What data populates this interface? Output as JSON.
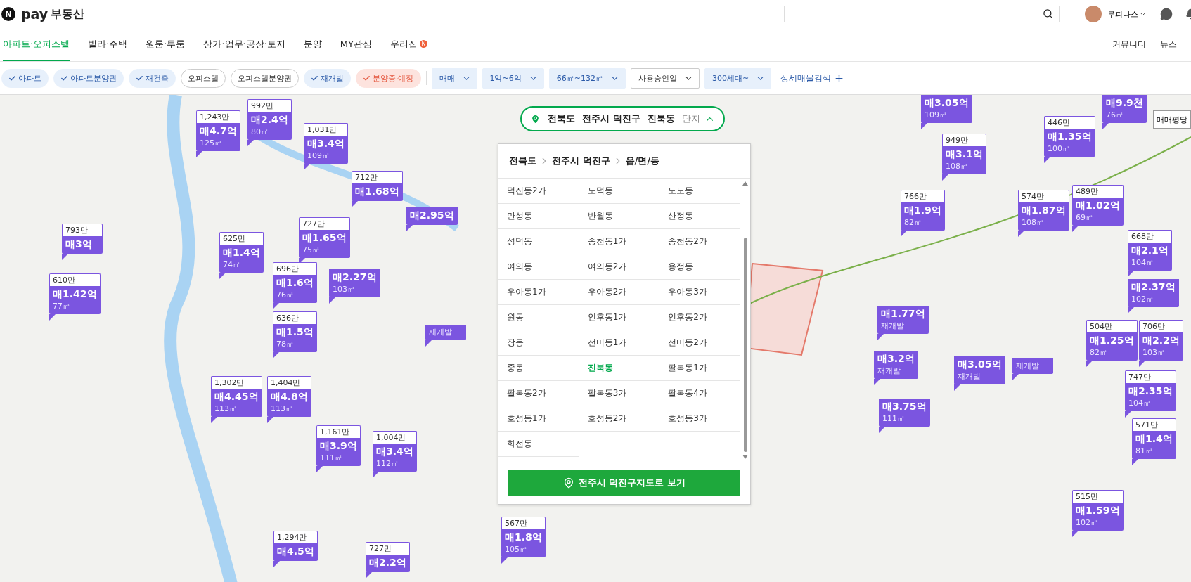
{
  "header": {
    "logo": {
      "mark": "N",
      "brand": "pay",
      "service": "부동산"
    },
    "user": {
      "name": "루피나스"
    }
  },
  "nav": {
    "tabs": [
      {
        "label": "아파트·오피스텔",
        "selected": true
      },
      {
        "label": "빌라·주택",
        "selected": false
      },
      {
        "label": "원룸·투룸",
        "selected": false
      },
      {
        "label": "상가·업무·공장·토지",
        "selected": false
      },
      {
        "label": "분양",
        "selected": false
      },
      {
        "label": "MY관심",
        "selected": false
      },
      {
        "label": "우리집",
        "selected": false,
        "badge": "N"
      }
    ],
    "links": [
      "커뮤니티",
      "뉴스"
    ]
  },
  "filters": [
    {
      "kind": "chip",
      "label": "아파트",
      "checked": true
    },
    {
      "kind": "chip",
      "label": "아파트분양권",
      "checked": true
    },
    {
      "kind": "chip",
      "label": "재건축",
      "checked": true
    },
    {
      "kind": "chip",
      "label": "오피스텔",
      "checked": false
    },
    {
      "kind": "chip",
      "label": "오피스텔분양권",
      "checked": false
    },
    {
      "kind": "chip",
      "label": "재개발",
      "checked": true
    },
    {
      "kind": "sale",
      "label": "분양중·예정",
      "checked": true
    },
    {
      "kind": "select",
      "label": "매매",
      "active": true
    },
    {
      "kind": "select",
      "label": "1억~6억",
      "active": true
    },
    {
      "kind": "select",
      "label": "66㎡~132㎡",
      "active": true
    },
    {
      "kind": "select",
      "label": "사용승인일",
      "active": false
    },
    {
      "kind": "select",
      "label": "300세대~",
      "active": true
    },
    {
      "kind": "link",
      "label": "상세매물검색"
    }
  ],
  "location": {
    "crumbs": [
      "전북도",
      "전주시 덕진구",
      "진북동"
    ],
    "toggle": "단지",
    "expanded": true
  },
  "region_panel": {
    "crumbs": [
      "전북도",
      "전주시 덕진구",
      "읍/면/동"
    ],
    "items": [
      {
        "label": "덕진동2가",
        "selected": false
      },
      {
        "label": "도덕동",
        "selected": false
      },
      {
        "label": "도도동",
        "selected": false
      },
      {
        "label": "만성동",
        "selected": false
      },
      {
        "label": "반월동",
        "selected": false
      },
      {
        "label": "산정동",
        "selected": false
      },
      {
        "label": "성덕동",
        "selected": false
      },
      {
        "label": "송천동1가",
        "selected": false
      },
      {
        "label": "송천동2가",
        "selected": false
      },
      {
        "label": "여의동",
        "selected": false
      },
      {
        "label": "여의동2가",
        "selected": false
      },
      {
        "label": "용정동",
        "selected": false
      },
      {
        "label": "우아동1가",
        "selected": false
      },
      {
        "label": "우아동2가",
        "selected": false
      },
      {
        "label": "우아동3가",
        "selected": false
      },
      {
        "label": "원동",
        "selected": false
      },
      {
        "label": "인후동1가",
        "selected": false
      },
      {
        "label": "인후동2가",
        "selected": false
      },
      {
        "label": "장동",
        "selected": false
      },
      {
        "label": "전미동1가",
        "selected": false
      },
      {
        "label": "전미동2가",
        "selected": false
      },
      {
        "label": "중동",
        "selected": false
      },
      {
        "label": "진북동",
        "selected": true
      },
      {
        "label": "팔복동1가",
        "selected": false
      },
      {
        "label": "팔복동2가",
        "selected": false
      },
      {
        "label": "팔복동3가",
        "selected": false
      },
      {
        "label": "팔복동4가",
        "selected": false
      },
      {
        "label": "호성동1가",
        "selected": false
      },
      {
        "label": "호성동2가",
        "selected": false
      },
      {
        "label": "호성동3가",
        "selected": false
      },
      {
        "label": "화전동",
        "selected": false
      }
    ],
    "button": "전주시 덕진구지도로 보기"
  },
  "map_legend_button": "매매평당",
  "markers": [
    {
      "count": "1,243만",
      "price": "매4.7억",
      "area": "125㎡"
    },
    {
      "count": "992만",
      "price": "매2.4억",
      "area": "80㎡"
    },
    {
      "price": "매3.05억",
      "area": "109㎡"
    },
    {
      "count": "446만",
      "price": "매1.35억",
      "area": "100㎡"
    },
    {
      "price": "매9.9천",
      "area": "76㎡"
    },
    {
      "count": "1,031만",
      "price": "매3.4억",
      "area": "109㎡"
    },
    {
      "count": "949만",
      "price": "매3.1억",
      "area": "108㎡"
    },
    {
      "count": "712만",
      "price": "매1.68억"
    },
    {
      "count": "766만",
      "price": "매1.9억",
      "area": "82㎡"
    },
    {
      "count": "574만",
      "price": "매1.87억",
      "area": "108㎡"
    },
    {
      "count": "489만",
      "price": "매1.02억",
      "area": "69㎡"
    },
    {
      "count": "793만",
      "price": "매3억"
    },
    {
      "count": "625만",
      "price": "매1.4억",
      "area": "74㎡"
    },
    {
      "count": "727만",
      "price": "매1.65억",
      "area": "75㎡"
    },
    {
      "price": "매2.95억"
    },
    {
      "count": "668만",
      "price": "매2.1억",
      "area": "104㎡"
    },
    {
      "count": "610만",
      "price": "매1.42억",
      "area": "77㎡"
    },
    {
      "count": "696만",
      "price": "매1.6억",
      "area": "76㎡"
    },
    {
      "price": "매2.27억",
      "area": "103㎡"
    },
    {
      "price": "매2.37억",
      "area": "102㎡"
    },
    {
      "count": "636만",
      "price": "매1.5억",
      "area": "78㎡"
    },
    {
      "area": "재개발"
    },
    {
      "price": "매1.77억",
      "area": "재개발"
    },
    {
      "count": "504만",
      "price": "매1.25억",
      "area": "82㎡"
    },
    {
      "count": "706만",
      "price": "매2.2억",
      "area": "103㎡"
    },
    {
      "count": "1,302만",
      "price": "매4.45억",
      "area": "113㎡"
    },
    {
      "count": "1,404만",
      "price": "매4.8억",
      "area": "113㎡"
    },
    {
      "price": "매3.2억",
      "area": "재개발"
    },
    {
      "price": "매3.05억",
      "area": "재개발"
    },
    {
      "area": "재개발"
    },
    {
      "count": "747만",
      "price": "매2.35억",
      "area": "104㎡"
    },
    {
      "count": "1,161만",
      "price": "매3.9억",
      "area": "111㎡"
    },
    {
      "price": "매3.75억",
      "area": "111㎡"
    },
    {
      "count": "571만",
      "price": "매1.4억",
      "area": "81㎡"
    },
    {
      "count": "1,004만",
      "price": "매3.4억",
      "area": "112㎡"
    },
    {
      "count": "567만",
      "price": "매1.8억",
      "area": "105㎡"
    },
    {
      "count": "515만",
      "price": "매1.59억",
      "area": "102㎡"
    },
    {
      "count": "1,294만",
      "price": "매4.5억"
    },
    {
      "count": "727만",
      "price": "매2.2억"
    }
  ]
}
